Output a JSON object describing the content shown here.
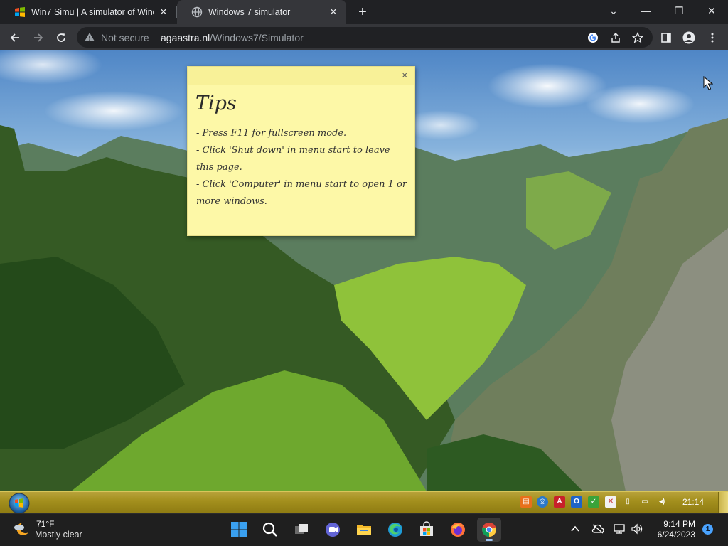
{
  "browser": {
    "tabs": [
      {
        "title": "Win7 Simu | A simulator of Windows 7",
        "icon": "windows7-favicon-icon",
        "active": false
      },
      {
        "title": "Windows 7 simulator",
        "icon": "globe-icon",
        "active": true
      }
    ],
    "new_tab_icon": "+",
    "window_controls": {
      "tab_search": "⌄",
      "minimize": "—",
      "restore": "❐",
      "close": "✕"
    },
    "omnibox": {
      "security_text": "Not secure",
      "url_host": "agaastra.nl",
      "url_path": "/Windows7/Simulator"
    }
  },
  "sticky_note": {
    "close_glyph": "×",
    "title": "Tips",
    "lines": [
      "- Press F11 for fullscreen mode.",
      "- Click 'Shut down' in menu start to leave this page.",
      "- Click 'Computer' in menu start to open 1 or more windows."
    ]
  },
  "win7_taskbar": {
    "clock": "21:14"
  },
  "win11_taskbar": {
    "weather": {
      "temp": "71°F",
      "condition": "Mostly clear"
    },
    "time": "9:14 PM",
    "date": "6/24/2023",
    "notification_count": "1",
    "accent_color": "#4aa3ff"
  }
}
